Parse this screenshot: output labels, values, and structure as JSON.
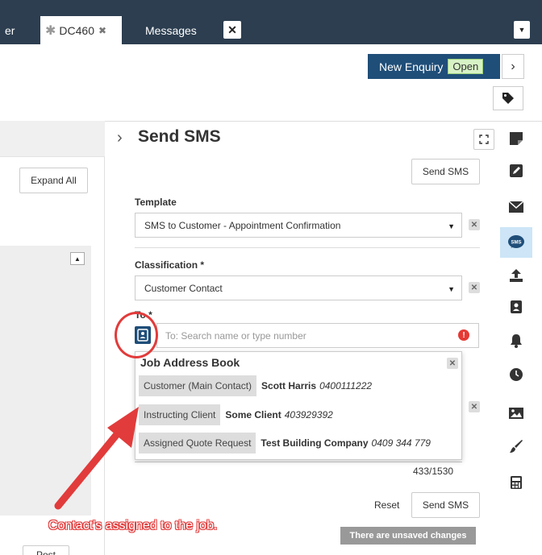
{
  "tabs": {
    "partial_label": "er",
    "active_label": "DC460",
    "messages_label": "Messages"
  },
  "header": {
    "new_enquiry_label": "New Enquiry",
    "status_badge": "Open"
  },
  "left_panel": {
    "expand_all_label": "Expand All",
    "post_label": "Post"
  },
  "sms_panel": {
    "title": "Send SMS",
    "send_label": "Send SMS",
    "template_label": "Template",
    "template_value": "SMS to Customer - Appointment Confirmation",
    "classification_label": "Classification *",
    "classification_value": "Customer Contact",
    "to_label": "To *",
    "to_placeholder": "To: Search name or type number",
    "char_counter": "433/1530",
    "reset_label": "Reset",
    "unsaved_notice": "There are unsaved changes"
  },
  "address_book": {
    "title": "Job Address Book",
    "contacts": [
      {
        "role": "Customer (Main Contact)",
        "name": "Scott Harris",
        "phone": "0400111222"
      },
      {
        "role": "Instructing Client",
        "name": "Some Client",
        "phone": "403929392"
      },
      {
        "role": "Assigned Quote Request",
        "name": "Test Building Company",
        "phone": "0409 344 779"
      }
    ]
  },
  "annotation": {
    "callout_text": "Contact's assigned to the job."
  },
  "rail_icons": [
    "sticky-note-icon",
    "edit-icon",
    "envelope-icon",
    "sms-icon",
    "upload-icon",
    "address-book-icon",
    "bell-icon",
    "clock-icon",
    "image-icon",
    "paintbrush-icon",
    "calculator-icon"
  ],
  "colors": {
    "tab_bar": "#2c3e50",
    "primary": "#1f4e79",
    "open_badge": "#d8f2c6",
    "annotation_red": "#e23b3b",
    "active_rail": "#cde5f7"
  }
}
